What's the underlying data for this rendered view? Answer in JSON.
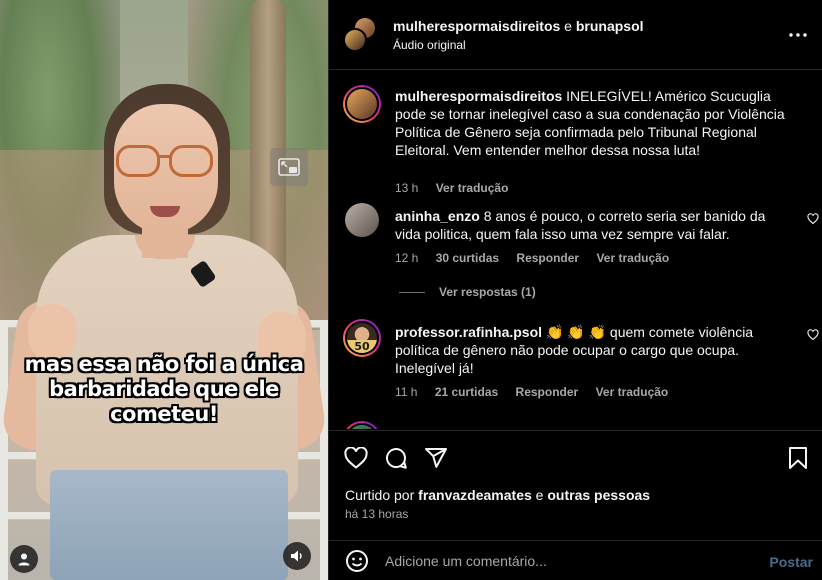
{
  "video": {
    "caption_lines": [
      "mas essa não foi a única",
      "barbaridade que ele",
      "cometeu!"
    ]
  },
  "header": {
    "author1": "mulherespormaisdireitos",
    "conj": "e",
    "author2": "brunapsol",
    "audio": "Áudio original"
  },
  "post": {
    "username": "mulherespormaisdireitos",
    "text": "INELEGÍVEL! Américo Scucuglia pode se tornar inelegível caso a sua condenação por Violência Política de Gênero seja confirmada pelo Tribunal Regional Eleitoral. Vem entender melhor dessa nossa luta!",
    "time": "13 h",
    "translate": "Ver tradução"
  },
  "comments": [
    {
      "username": "aninha_enzo",
      "text": "8 anos é pouco, o correto seria ser banido da vida politica, quem fala isso uma vez sempre vai falar.",
      "time": "12 h",
      "likes": "30 curtidas",
      "reply": "Responder",
      "translate": "Ver tradução"
    },
    {
      "username": "professor.rafinha.psol",
      "text": "👏 👏 👏 quem comete violência política de gênero não pode ocupar o cargo que ocupa. Inelegível já!",
      "time": "11 h",
      "likes": "21 curtidas",
      "reply": "Responder",
      "translate": "Ver tradução",
      "avatar_badge": "50"
    }
  ],
  "replies_toggle": "Ver respostas (1)",
  "liked_by": {
    "prefix": "Curtido por",
    "user": "franvazdeamates",
    "conj": "e",
    "others": "outras pessoas"
  },
  "post_time": "há 13 horas",
  "add_comment": {
    "placeholder": "Adicione um comentário...",
    "post_label": "Postar"
  },
  "colors": {
    "background": "#000000",
    "muted_text": "#a8a8a8",
    "post_button": "#4a6b8a",
    "divider": "#262626"
  }
}
